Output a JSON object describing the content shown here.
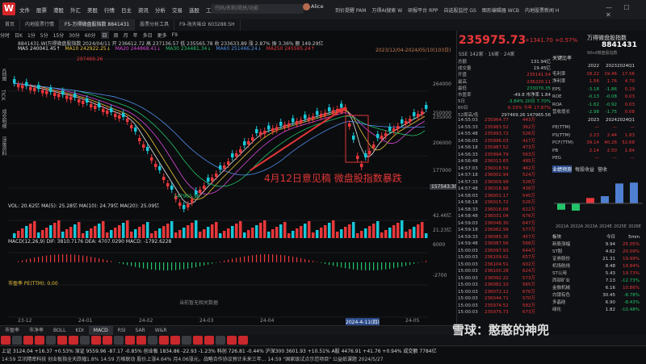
{
  "app": {
    "logo": "W",
    "menu": [
      "文件",
      "股票",
      "港股",
      "外汇",
      "美股",
      "行情",
      "日主",
      "资讯",
      "分析",
      "交易",
      "选股",
      "工具",
      "帮助"
    ],
    "search_placeholder": "代码/名称/简拼/功能",
    "user": "Alice",
    "right_nav": [
      "到价提醒 PAM",
      "万得AI搜索 W",
      "研报平台 RPP",
      "自选股监控 GS",
      "图形编辑器 WCB",
      "内地股票新闻 H"
    ],
    "window_controls": "— ☐ ✕"
  },
  "tabs": [
    "首页",
    "内地股票行情",
    "F5-万得微盘股指数 8841431",
    "股票分析工具",
    "F9-海天味业 603288.SH"
  ],
  "chart": {
    "periods": [
      "分时",
      "日K",
      "1分",
      "5分",
      "15分",
      "30分",
      "60分",
      "日",
      "周",
      "月",
      "年",
      "多日",
      "更多",
      "F9"
    ],
    "active_period": "日",
    "title_line": "8841431.WI万得微盘股指数  2024/04/11  开 236612.72  高 237136.57  低 235565.78  收 233633.89  涨 2.87%  振 3.36%  额 149.29亿",
    "ma_line": [
      {
        "label": "MA5 240041.45↑",
        "color": "#e6e6e6"
      },
      {
        "label": "MA10 242922.25↓",
        "color": "#e8c33a"
      },
      {
        "label": "MA20 244868.41↓",
        "color": "#d94ad9"
      },
      {
        "label": "MA30 234481.34↓",
        "color": "#23c36a"
      },
      {
        "label": "MA60 251466.24↓",
        "color": "#4f8ee8"
      },
      {
        "label": "MA250 245565.24↑",
        "color": "#e8373a"
      }
    ],
    "date_range": "2023/12/04-2024/05/10(103日)",
    "sidebar": [
      "K线图",
      "TICK",
      "成交明细",
      "深度资料"
    ],
    "y_axis": [
      "264000",
      "250000",
      "235000",
      "206000",
      "177000"
    ],
    "price_label": "157543.30",
    "high_label": "297469.26",
    "low_label": "147965.56",
    "annotation": "4月12日意见稿 微盘股指数暴跌",
    "vol_line": "VOL: 20.62亿  MA(5): 25.28亿  MA(10): 24.79亿  MA(20): 25.09亿",
    "vol_axis": [
      "42.46亿",
      "21.23亿"
    ],
    "macd_line": "MACD(12,26,9)  DIF: 3810.7176  DEA: 4707.0290  MACD: -1792.6228",
    "macd_axis": [
      "6000",
      "-2700"
    ],
    "pe_line": "市盈率  PE(TTM): 0.00",
    "pe_empty": "当前暂无相关数据",
    "x_axis": [
      "23-12",
      "24-01",
      "24-02",
      "24-03",
      "24-04",
      "2024-4-11(四)",
      "24-05"
    ]
  },
  "indicator_tabs": [
    "市盈率",
    "市净率",
    "BOLL",
    "KDI",
    "MACD",
    "RSI",
    "SAR",
    "W&R"
  ],
  "active_indicator": "MACD",
  "ticker": {
    "line1": "上证 3124.04 +16.37 +0.53%  深证 9559.96 -87.17 -0.85%  创业板 1834.86 -22.93 -1.23%  科创 726.81 -0.44%  沪深300 3601.93 +10.51%  A股 4476.91 +41.76 +0.94%  成交额 7784亿",
    "line2": "14:59  立讯精密科技  创业板指全天跌幅1.8%  14:59 方格联动  股价上涨4.64% 月4.06涨元，战略合作协议预计未来三年...  14:59 \"国家级试点示范项目\" 公益纸课题  2024/5/27",
    "time": "14:59:23"
  },
  "quote": {
    "price": "235975.73",
    "change": "+1341.70  +0.57%",
    "name": "万得微盘股指数",
    "code": "8841431",
    "sub": "Wind微盘股指数",
    "rank_prefix": "SSE",
    "rank": "142家  ·  16家  ·  24家",
    "left_kv": [
      {
        "k": "总额",
        "v": "131.94亿",
        "c": "wht"
      },
      {
        "k": "成交量",
        "v": "19.45亿",
        "c": "wht"
      },
      {
        "k": "开盘",
        "v": "235141.54",
        "c": "red"
      },
      {
        "k": "最高",
        "v": "236220.11",
        "c": "red"
      },
      {
        "k": "最低",
        "v": "233070.35",
        "c": "grn"
      },
      {
        "k": "市盈率",
        "v": "-49.8  市净率  1.84",
        "c": "wht"
      },
      {
        "k": "5日",
        "v": "-3.84%  20日  7.70%",
        "c": "grn"
      },
      {
        "k": "60日",
        "v": "6.33%  今年  17.87%",
        "c": "red"
      },
      {
        "k": "52周高/低",
        "v": "297469.26  147965.56",
        "c": "wht"
      }
    ],
    "ticks": [
      [
        "14:55:03",
        "235964.77",
        "443万"
      ],
      [
        "14:55:33",
        "235983.52",
        "362万"
      ],
      [
        "14:55:48",
        "235993.72",
        "526万"
      ],
      [
        "14:56:03",
        "235996.03",
        "417万"
      ],
      [
        "14:56:18",
        "235987.52",
        "473万"
      ],
      [
        "14:56:33",
        "235994.79",
        "563万"
      ],
      [
        "14:56:48",
        "236013.83",
        "495万"
      ],
      [
        "14:57:03",
        "236018.59",
        "462万"
      ],
      [
        "14:57:18",
        "236002.94",
        "524万"
      ],
      [
        "14:57:33",
        "236009.99",
        "528万"
      ],
      [
        "14:57:48",
        "236016.98",
        "438万"
      ],
      [
        "14:58:03",
        "236001.17",
        "545万"
      ],
      [
        "14:58:18",
        "236015.72",
        "526万"
      ],
      [
        "14:58:33",
        "236016.08",
        "622万"
      ],
      [
        "14:58:48",
        "236031.04",
        "676万"
      ],
      [
        "14:59:03",
        "236048.30",
        "647万"
      ],
      [
        "14:59:18",
        "236062.99",
        "577万"
      ],
      [
        "14:59:33",
        "236085.35",
        "457万"
      ],
      [
        "14:59:48",
        "236087.56",
        "568万"
      ],
      [
        "15:00:03",
        "236097.93",
        "644万"
      ],
      [
        "15:00:03",
        "236109.01",
        "657万"
      ],
      [
        "15:00:03",
        "236104.51",
        "602万"
      ],
      [
        "15:00:03",
        "236100.28",
        "624万"
      ],
      [
        "15:00:03",
        "236092.22",
        "573万"
      ],
      [
        "15:00:03",
        "236082.10",
        "565万"
      ],
      [
        "15:00:03",
        "236072.12",
        "676万"
      ],
      [
        "15:00:03",
        "236044.71",
        "570万"
      ],
      [
        "15:00:03",
        "235974.52",
        "582万"
      ],
      [
        "15:00:03",
        "235975.73",
        "673万"
      ]
    ]
  },
  "financials": {
    "title": "关键比率",
    "years": [
      "",
      "2022",
      "2023",
      "2024Q1"
    ],
    "rows": [
      [
        "毛利率",
        "18.22",
        "19.46",
        "17.56"
      ],
      [
        "净利率",
        "1.56",
        "1.76",
        "4.70"
      ],
      [
        "EPS",
        "-3.18",
        "-1.86",
        "0.29"
      ],
      [
        "ROE",
        "-0.13",
        "-0.08",
        "0.03"
      ],
      [
        "ROA",
        "-1.62",
        "-0.92",
        "0.03"
      ],
      [
        "营收增长",
        "-2.98",
        "-1.75",
        "0.08"
      ]
    ],
    "val_years": [
      "",
      "2023",
      "2024",
      "2024Q1"
    ],
    "val_rows": [
      [
        "PE(TTM)",
        "—",
        "—",
        "—"
      ],
      [
        "PS(TTM)",
        "2.23",
        "2.44",
        "1.83"
      ],
      [
        "PCF(TTM)",
        "39.14",
        "40.26",
        "52.68"
      ],
      [
        "PB",
        "2.14",
        "2.50",
        "1.84"
      ],
      [
        "PEG",
        "—",
        "—",
        "—"
      ]
    ],
    "forecast_tabs": [
      "业绩预测",
      "每股收益",
      "营收"
    ],
    "forecast_bars": [
      "2021A",
      "2022A",
      "2023A",
      "2024E",
      "2025E",
      "2026E"
    ],
    "forecast_values": [
      -14,
      -16,
      12,
      16,
      44,
      46
    ]
  },
  "sectors": {
    "header": [
      "板块",
      "今日",
      "5min"
    ],
    "rows": [
      [
        "新股涨幅",
        "9.94",
        "25.05%"
      ],
      [
        "ST股",
        "4.62",
        "20.09%"
      ],
      [
        "证券股份",
        "21.31",
        "19.99%"
      ],
      [
        "机场航线",
        "8.48",
        "19.84%"
      ],
      [
        "ST公用",
        "5.43",
        "19.73%"
      ],
      [
        "西部矿业",
        "7.13",
        "-12.73%"
      ],
      [
        "金融机械",
        "6.16",
        "10.86%"
      ],
      [
        "白银有色",
        "30.45",
        "-8.78%"
      ],
      [
        "多晶硅",
        "6.90",
        "-8.43%"
      ],
      [
        "绿化",
        "1.82",
        "-10.48%"
      ]
    ]
  },
  "watermark": "雪球：憨憨的神兜"
}
